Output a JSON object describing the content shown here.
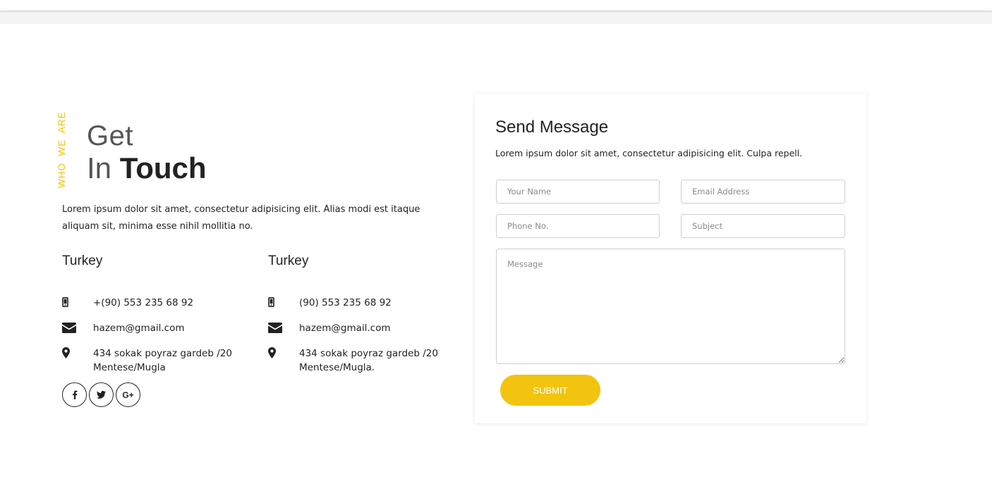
{
  "section": {
    "vertical_tag": "WHO  WE  ARE",
    "heading": {
      "line1": "Get",
      "line2_light": "In",
      "line2_bold": "Touch"
    },
    "intro": "Lorem ipsum dolor sit amet, consectetur adipisicing elit. Alias modi est itaque aliquam sit, minima esse nihil mollitia no."
  },
  "offices": [
    {
      "title": "Turkey",
      "phone": "+(90) 553 235 68 92",
      "email": "hazem@gmail.com",
      "address": "434 sokak poyraz gardeb /20 Mentese/Mugla"
    },
    {
      "title": "Turkey",
      "phone": "(90) 553 235 68 92",
      "email": "hazem@gmail.com",
      "address": "434 sokak poyraz gardeb /20 Mentese/Mugla."
    }
  ],
  "socials": [
    {
      "icon": "facebook-icon"
    },
    {
      "icon": "twitter-icon"
    },
    {
      "icon": "google-plus-icon"
    }
  ],
  "form": {
    "title": "Send Message",
    "description": "Lorem ipsum dolor sit amet, consectetur adipisicing elit. Culpa repell.",
    "name_placeholder": "Your Name",
    "email_placeholder": "Email Address",
    "phone_placeholder": "Phone No.",
    "subject_placeholder": "Subject",
    "message_placeholder": "Message",
    "submit_label": "SUBMIT"
  },
  "colors": {
    "accent": "#f2c40f",
    "text": "#222222",
    "border": "#cfcfcf"
  }
}
